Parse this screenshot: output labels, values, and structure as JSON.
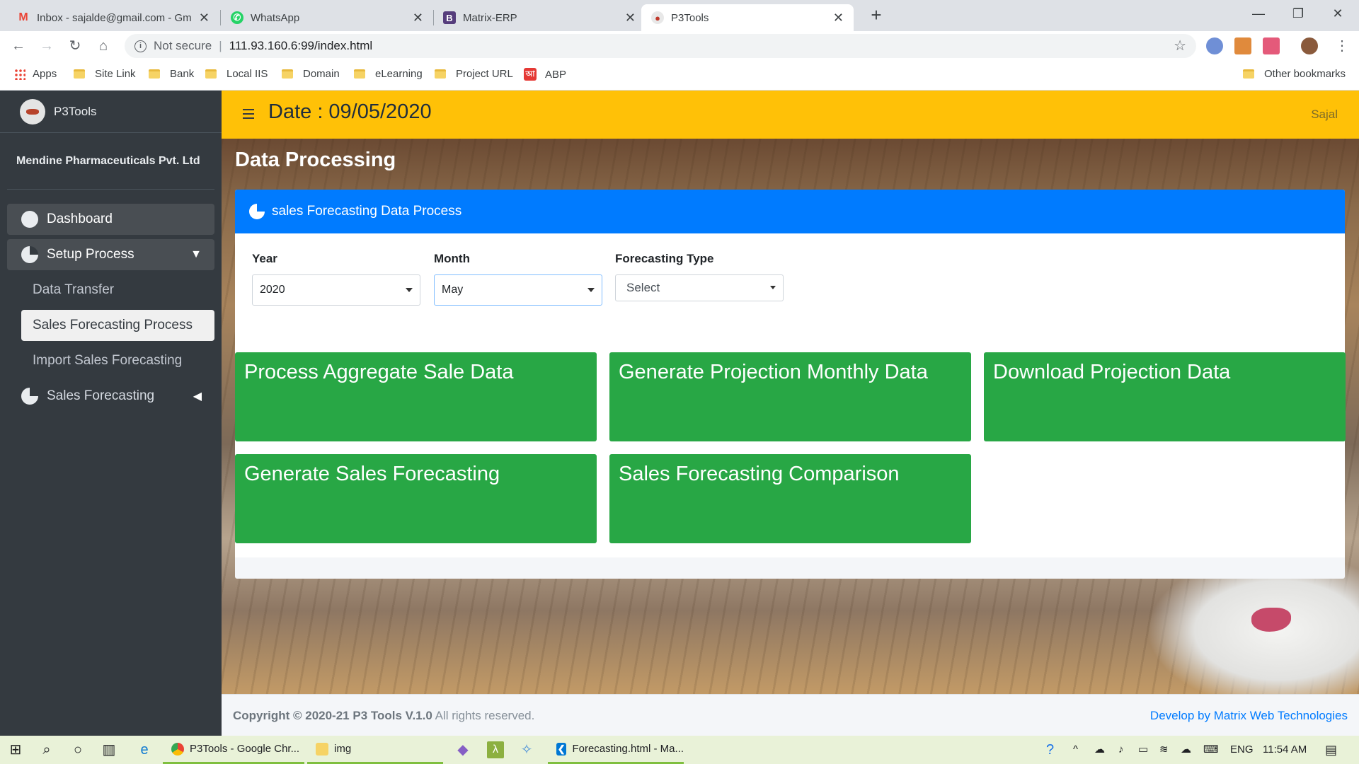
{
  "browser": {
    "tabs": [
      {
        "title": "Inbox - sajalde@gmail.com - Gm",
        "icon": "gmail-icon",
        "active": false
      },
      {
        "title": "WhatsApp",
        "icon": "whatsapp-icon",
        "active": false
      },
      {
        "title": "Matrix-ERP",
        "icon": "bootstrap-icon",
        "active": false
      },
      {
        "title": "P3Tools",
        "icon": "p3tools-icon",
        "active": true
      }
    ],
    "security_label": "Not secure",
    "url": "111.93.160.6:99/index.html",
    "bookmarks": [
      "Apps",
      "Site Link",
      "Bank",
      "Local IIS",
      "Domain",
      "eLearning",
      "Project URL",
      "ABP"
    ],
    "other_bookmarks": "Other bookmarks"
  },
  "app": {
    "brand": "P3Tools",
    "company": "Mendine Pharmaceuticals Pvt. Ltd",
    "menu": {
      "dashboard": "Dashboard",
      "setup_process": "Setup Process",
      "sub_items": [
        "Data Transfer",
        "Sales Forecasting Process",
        "Import Sales Forecasting"
      ],
      "sales_forecasting": "Sales Forecasting"
    },
    "header": {
      "date": "Date : 09/05/2020",
      "user": "Sajal"
    },
    "page_title": "Data Processing",
    "card": {
      "title": "sales Forecasting Data Process",
      "fields": {
        "year_label": "Year",
        "year_value": "2020",
        "month_label": "Month",
        "month_value": "May",
        "type_label": "Forecasting Type",
        "type_value": "Select"
      },
      "tiles": [
        "Process Aggregate Sale Data",
        "Generate Projection Monthly Data",
        "Download Projection Data",
        "Generate Sales Forecasting",
        "Sales Forecasting Comparison"
      ]
    },
    "footer": {
      "copyright_bold": "Copyright © 2020-21 P3 Tools V.1.0",
      "copyright_rest": " All rights reserved.",
      "developer": "Develop by Matrix Web Technologies"
    }
  },
  "taskbar": {
    "apps": [
      "P3Tools - Google Chr...",
      "img",
      "Forecasting.html - Ma..."
    ],
    "language": "ENG",
    "time": "11:54 AM"
  },
  "colors": {
    "sidebar": "#343a40",
    "header": "#ffc107",
    "card_header": "#007bff",
    "tile": "#28a745"
  }
}
